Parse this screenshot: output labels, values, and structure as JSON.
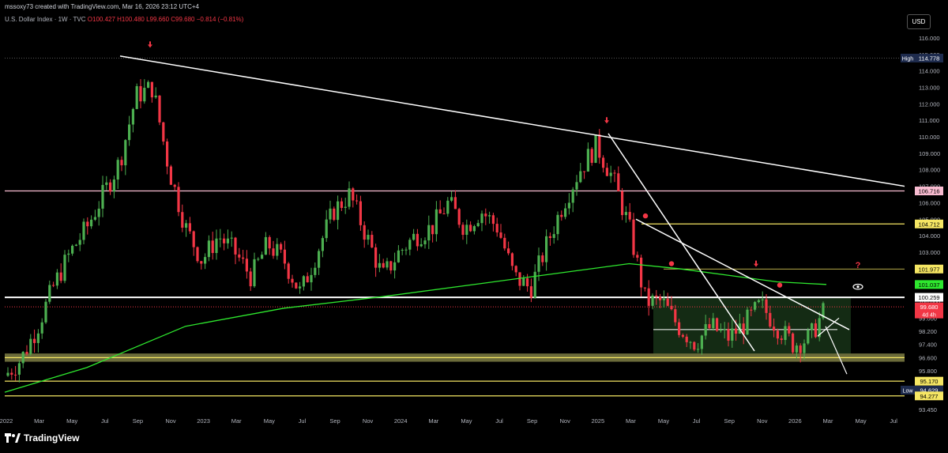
{
  "header": {
    "text": "mssoxy73 created with TradingView.com, Mar 16, 2026 23:12 UTC+4"
  },
  "legend": {
    "symbol": "U.S. Dollar Index · 1W · TVC",
    "open": "O100.427",
    "high": "H100.480",
    "low": "L99.660",
    "close": "C99.680",
    "change": "−0.814 (−0.81%)"
  },
  "currency": "USD",
  "brand": "TradingView",
  "colors": {
    "up": "#089981",
    "upBody": "#4caf50",
    "down": "#f23645",
    "ma": "#2ee82e",
    "trend": "#ffffff",
    "yellow": "#f5e663",
    "pink": "#f8bbd0"
  },
  "chart_data": {
    "type": "candlestick",
    "y_axis": {
      "range": [
        93.0,
        116.6
      ],
      "ticks": [
        "116.000",
        "115.000",
        "114.000",
        "113.000",
        "112.000",
        "111.000",
        "110.000",
        "109.000",
        "108.000",
        "107.000",
        "106.000",
        "105.000",
        "104.000",
        "103.000",
        "102.000",
        "101.000",
        "100.000",
        "99.000",
        "98.200",
        "97.400",
        "96.600",
        "95.800",
        "93.450"
      ]
    },
    "x_axis": {
      "ticks": [
        "2022",
        "Mar",
        "May",
        "Jul",
        "Sep",
        "Nov",
        "2023",
        "Mar",
        "May",
        "Jul",
        "Sep",
        "Nov",
        "2024",
        "Mar",
        "May",
        "Jul",
        "Sep",
        "Nov",
        "2025",
        "Mar",
        "May",
        "Jul",
        "Sep",
        "Nov",
        "2026",
        "Mar",
        "May",
        "Jul"
      ]
    },
    "price_labels": [
      {
        "text": "High",
        "value": "114.778",
        "kind": "high"
      },
      {
        "text": "",
        "value": "106.716",
        "kind": "pink"
      },
      {
        "text": "",
        "value": "104.712",
        "kind": "yellow"
      },
      {
        "text": "",
        "value": "101.977",
        "kind": "yellow"
      },
      {
        "text": "",
        "value": "101.037",
        "kind": "ma"
      },
      {
        "text": "",
        "value": "100.259",
        "kind": "white"
      },
      {
        "text": "",
        "value": "99.680",
        "kind": "last",
        "sub": "4d 4h"
      },
      {
        "text": "",
        "value": "95.170",
        "kind": "yellow"
      },
      {
        "text": "Low",
        "value": "94.629",
        "kind": "low"
      },
      {
        "text": "",
        "value": "94.277",
        "kind": "yellow"
      }
    ],
    "horizontal_levels": [
      {
        "value": 114.778,
        "style": "dotted-grey"
      },
      {
        "value": 106.716,
        "style": "pink"
      },
      {
        "value": 104.712,
        "style": "yellow"
      },
      {
        "value": 101.977,
        "style": "yellow-thin"
      },
      {
        "value": 100.259,
        "style": "white-thick"
      },
      {
        "value": 99.68,
        "style": "red-dotted"
      },
      {
        "value": 96.6,
        "style": "yellow-band"
      },
      {
        "value": 95.17,
        "style": "yellow"
      },
      {
        "value": 94.277,
        "style": "yellow"
      }
    ],
    "annotation_question": "?",
    "price_path": [
      [
        "2022-01",
        95.5
      ],
      [
        "2022-02",
        96.5
      ],
      [
        "2022-03",
        98.5
      ],
      [
        "2022-04",
        101.0
      ],
      [
        "2022-05",
        103.0
      ],
      [
        "2022-06",
        104.5
      ],
      [
        "2022-07",
        106.5
      ],
      [
        "2022-08",
        108.5
      ],
      [
        "2022-09",
        112.5
      ],
      [
        "2022-10",
        113.0
      ],
      [
        "2022-11",
        108.0
      ],
      [
        "2022-12",
        104.5
      ],
      [
        "2023-01",
        102.5
      ],
      [
        "2023-02",
        104.0
      ],
      [
        "2023-03",
        103.0
      ],
      [
        "2023-04",
        101.5
      ],
      [
        "2023-05",
        103.5
      ],
      [
        "2023-06",
        102.5
      ],
      [
        "2023-07",
        100.5
      ],
      [
        "2023-08",
        103.0
      ],
      [
        "2023-09",
        105.5
      ],
      [
        "2023-10",
        106.5
      ],
      [
        "2023-11",
        104.0
      ],
      [
        "2023-12",
        101.5
      ],
      [
        "2024-01",
        103.0
      ],
      [
        "2024-02",
        104.0
      ],
      [
        "2024-03",
        104.5
      ],
      [
        "2024-04",
        106.0
      ],
      [
        "2024-05",
        104.5
      ],
      [
        "2024-06",
        105.5
      ],
      [
        "2024-07",
        104.5
      ],
      [
        "2024-08",
        101.5
      ],
      [
        "2024-09",
        100.8
      ],
      [
        "2024-10",
        103.5
      ],
      [
        "2024-11",
        106.0
      ],
      [
        "2024-12",
        108.0
      ],
      [
        "2025-01",
        109.5
      ],
      [
        "2025-02",
        107.5
      ],
      [
        "2025-03",
        104.5
      ],
      [
        "2025-04",
        100.0
      ],
      [
        "2025-05",
        100.0
      ],
      [
        "2025-06",
        98.5
      ],
      [
        "2025-07",
        97.5
      ],
      [
        "2025-08",
        98.5
      ],
      [
        "2025-09",
        97.8
      ],
      [
        "2025-10",
        98.6
      ],
      [
        "2025-11",
        99.8
      ],
      [
        "2025-12",
        98.5
      ],
      [
        "2026-01",
        97.4
      ],
      [
        "2026-02",
        97.8
      ],
      [
        "2026-03",
        99.68
      ]
    ],
    "ma_path": [
      [
        "2022-01",
        94.5
      ],
      [
        "2022-06",
        96.0
      ],
      [
        "2022-12",
        98.5
      ],
      [
        "2023-06",
        99.6
      ],
      [
        "2023-12",
        100.3
      ],
      [
        "2024-06",
        101.1
      ],
      [
        "2024-12",
        101.9
      ],
      [
        "2025-03",
        102.3
      ],
      [
        "2025-06",
        102.0
      ],
      [
        "2025-09",
        101.6
      ],
      [
        "2025-12",
        101.2
      ],
      [
        "2026-03",
        101.04
      ]
    ]
  }
}
